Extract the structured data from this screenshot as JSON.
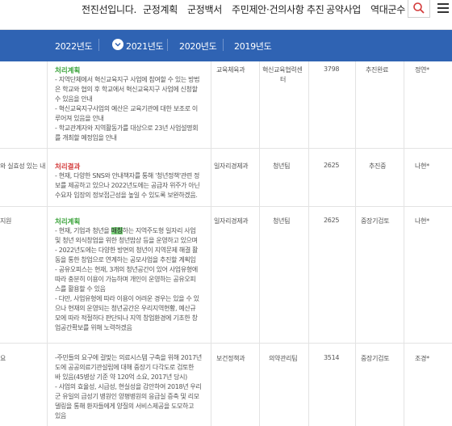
{
  "nav": {
    "items": [
      "전진선입니다.",
      "군정계획",
      "군정백서",
      "주민제안·건의사항 추진",
      "공약사업",
      "역대군수"
    ]
  },
  "year_tabs": [
    {
      "label": "2022년도",
      "selected": false
    },
    {
      "label": "2021년도",
      "selected": true
    },
    {
      "label": "2020년도",
      "selected": false
    },
    {
      "label": "2019년도",
      "selected": false
    }
  ],
  "rows": [
    {
      "left_text": "",
      "section": "처리계획",
      "section_color": "#3aa33a",
      "lines": [
        "- 지역단체에서 혁신교육지구 사업에 참여할 수 있는 방법",
        "은 학교와 협의 후 학교에서 혁신교육지구 사업에 신청할",
        "수 있음을 안내",
        "- 혁신교육지구사업의 예산은 교육기관에 대한 보조로 이",
        "루어져 있음을 안내",
        "- 학교관계자와 지역활동가를 대상으로 23년 사업설명회",
        "를 개최할 예정임을 안내"
      ],
      "dept": "교육체육과",
      "team": "혁신교육협력센터",
      "team_lines": [
        "혁신교육협력센",
        "터"
      ],
      "num": "3798",
      "status": "추진완료",
      "person": "정연*"
    },
    {
      "left_text": "와 실효성 있는 내",
      "section": "처리결과",
      "section_color": "#d33b3b",
      "lines": [
        "- 현재, 다양한 SNS와 안내책자를 통해 '청년정책'관련 정",
        "보를 제공하고 있으나 2022년도에는 공급자 위주가 아닌",
        "수요자 입장의 정보접근성을 높일 수 있도록 보완하겠음."
      ],
      "dept": "일자리경제과",
      "team": "청년팀",
      "team_lines": [
        "청년팀"
      ],
      "num": "2625",
      "status": "추진중",
      "person": "나현*"
    },
    {
      "left_text": "지원",
      "section": "처리계획",
      "section_color": "#3aa33a",
      "lines": [
        "- 현재, 기업과 청년을 매칭하는 지역주도형 일자리 사업",
        "및 청년 외식창업을 위한 청년밥상 등을 운영하고 있으며",
        "- 2022년도에는 다양한 방면의 청년이 지역문제 해결 활",
        "동을 통한 창업으로 연계하는 공모사업을 추진할 계획임",
        "- 공유오피스는 현재, 3개의 청년공간이 있어 사업유형에",
        "따라 충분히 이용이 가능하며 개인이 운영하는 공유오피",
        "스를 활용할 수 있음",
        "- 다만, 사업유형에 따라 이용이 어려운 경우는 있을 수 있",
        "으나 현재의 운영되는 청년공간은 우리지역현황, 예산규",
        "모에 따라 적절하다 판단되나 지역 창업환경에 기초한 창",
        "업공간확보를 위해 노력하겠음"
      ],
      "highlight_word": "매칭",
      "dept": "일자리경제과",
      "team": "청년팀",
      "team_lines": [
        "청년팀"
      ],
      "num": "2625",
      "status": "중장기검토",
      "person": "나현*"
    },
    {
      "left_text": "요",
      "section": "",
      "section_color": "",
      "lines": [
        "-주민들의 요구에 걸맞는 의료시스템 구축을 위해 2017년",
        "도에 공공의료기관설립에 대해 중장기 다각도로 검토한",
        "바 있음(45병상 기준 약 120억 소요, 2017년 당시)",
        "- 사업의 효율성, 시급성, 현실성을 감안하여 2018년 우리",
        "군 유일의 급성기 병원인 양평병원의 응급실 증축 및 리모",
        "델링을 통해 환자들에게 양질의 서비스제공을 도모하고",
        "있음"
      ],
      "dept": "보건정책과",
      "team": "의약관리팀",
      "team_lines": [
        "의약관리팀"
      ],
      "num": "3514",
      "status": "중장기검토",
      "person": "조경*"
    }
  ]
}
